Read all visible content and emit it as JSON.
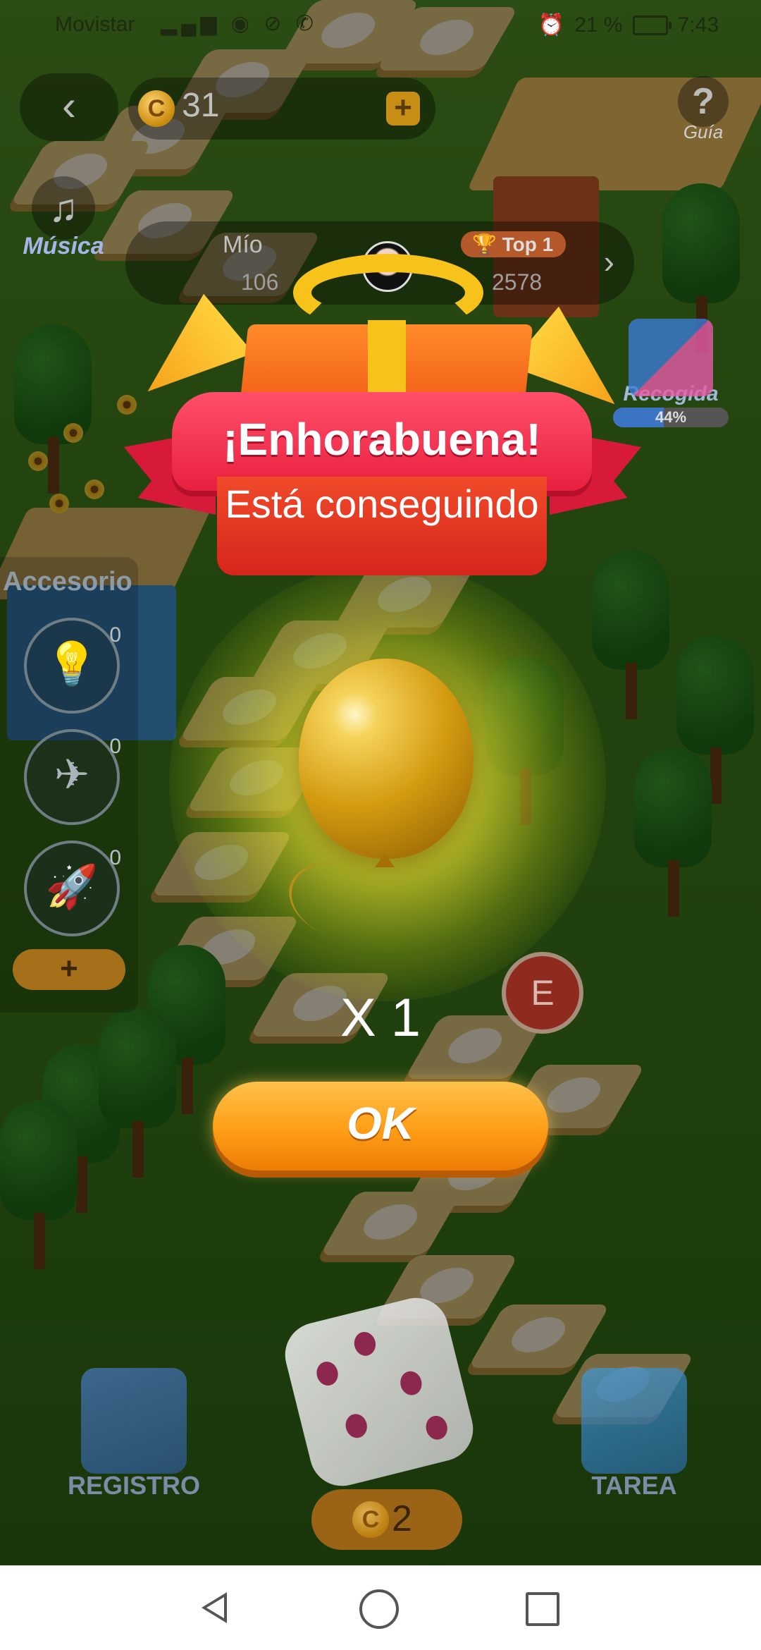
{
  "status_bar": {
    "carrier": "Movistar",
    "icons": "▂▄▆ ◉ ⊘ ✆",
    "battery_pct": "21 %",
    "time": "7:43"
  },
  "hud": {
    "back_icon": "‹",
    "coin_symbol": "C",
    "coins": "31",
    "coin_plus": "+",
    "guide_icon": "?",
    "guide_label": "Guía",
    "music_icon": "♫",
    "music_label": "Música"
  },
  "ranking": {
    "mine_label": "Mío",
    "mine_score": "106",
    "top_label": "Top 1",
    "top_score": "2578",
    "arrow": "›"
  },
  "collection": {
    "label": "Recogida",
    "percent_text": "44%",
    "percent_value": 44
  },
  "accessories": {
    "title": "Accesorio",
    "items": [
      {
        "icon": "lightbulb-icon",
        "glyph": "💡",
        "count": "0"
      },
      {
        "icon": "shoe-icon",
        "glyph": "✈",
        "count": "0"
      },
      {
        "icon": "rocket-icon",
        "glyph": "🚀",
        "count": "0"
      }
    ],
    "add_label": "+"
  },
  "board": {
    "token_label": "E"
  },
  "bottom": {
    "registro_label": "REGISTRO",
    "tarea_label": "TAREA",
    "roll_coin_symbol": "C",
    "roll_count": "2"
  },
  "modal": {
    "title": "¡Enhorabuena!",
    "subtitle": "Está conseguindo",
    "reward_icon": "golden-balloon-icon",
    "quantity": "X 1",
    "ok_label": "OK"
  },
  "colors": {
    "ok_button": "#ff9d17",
    "banner": "#e8203f",
    "glow": "#f0e632"
  }
}
